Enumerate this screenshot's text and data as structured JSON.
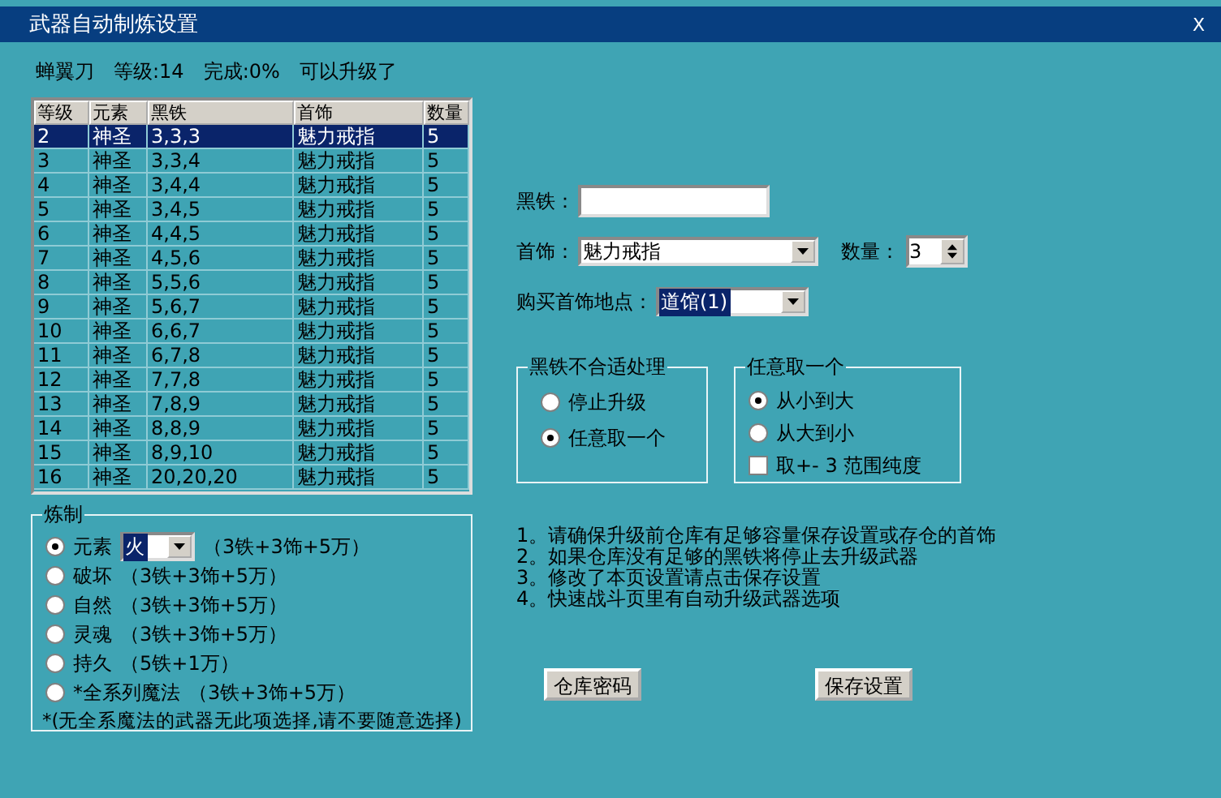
{
  "window": {
    "title": "武器自动制炼设置",
    "close": "X"
  },
  "status": {
    "weapon": "蝉翼刀",
    "level": "等级:14",
    "progress": "完成:0%",
    "message": "可以升级了"
  },
  "table": {
    "columns": [
      "等级",
      "元素",
      "黑铁",
      "首饰",
      "数量"
    ],
    "rows": [
      {
        "cells": [
          "2",
          "神圣",
          "3,3,3",
          "魅力戒指",
          "5"
        ],
        "selected": true
      },
      {
        "cells": [
          "3",
          "神圣",
          "3,3,4",
          "魅力戒指",
          "5"
        ],
        "selected": false
      },
      {
        "cells": [
          "4",
          "神圣",
          "3,4,4",
          "魅力戒指",
          "5"
        ],
        "selected": false
      },
      {
        "cells": [
          "5",
          "神圣",
          "3,4,5",
          "魅力戒指",
          "5"
        ],
        "selected": false
      },
      {
        "cells": [
          "6",
          "神圣",
          "4,4,5",
          "魅力戒指",
          "5"
        ],
        "selected": false
      },
      {
        "cells": [
          "7",
          "神圣",
          "4,5,6",
          "魅力戒指",
          "5"
        ],
        "selected": false
      },
      {
        "cells": [
          "8",
          "神圣",
          "5,5,6",
          "魅力戒指",
          "5"
        ],
        "selected": false
      },
      {
        "cells": [
          "9",
          "神圣",
          "5,6,7",
          "魅力戒指",
          "5"
        ],
        "selected": false
      },
      {
        "cells": [
          "10",
          "神圣",
          "6,6,7",
          "魅力戒指",
          "5"
        ],
        "selected": false
      },
      {
        "cells": [
          "11",
          "神圣",
          "6,7,8",
          "魅力戒指",
          "5"
        ],
        "selected": false
      },
      {
        "cells": [
          "12",
          "神圣",
          "7,7,8",
          "魅力戒指",
          "5"
        ],
        "selected": false
      },
      {
        "cells": [
          "13",
          "神圣",
          "7,8,9",
          "魅力戒指",
          "5"
        ],
        "selected": false
      },
      {
        "cells": [
          "14",
          "神圣",
          "8,8,9",
          "魅力戒指",
          "5"
        ],
        "selected": false
      },
      {
        "cells": [
          "15",
          "神圣",
          "8,9,10",
          "魅力戒指",
          "5"
        ],
        "selected": false
      },
      {
        "cells": [
          "16",
          "神圣",
          "20,20,20",
          "魅力戒指",
          "5"
        ],
        "selected": false
      }
    ]
  },
  "refine": {
    "title": "炼制",
    "options": [
      {
        "label": "元素",
        "selected": true,
        "dropdown": "火",
        "cost": "（3铁+3饰+5万）"
      },
      {
        "label": "破坏",
        "selected": false,
        "cost": "（3铁+3饰+5万）"
      },
      {
        "label": "自然",
        "selected": false,
        "cost": "（3铁+3饰+5万）"
      },
      {
        "label": "灵魂",
        "selected": false,
        "cost": "（3铁+3饰+5万）"
      },
      {
        "label": "持久",
        "selected": false,
        "cost": "（5铁+1万）"
      },
      {
        "label": "*全系列魔法",
        "selected": false,
        "cost": "（3铁+3饰+5万）"
      }
    ],
    "note": "*(无全系魔法的武器无此项选择,请不要随意选择)"
  },
  "form": {
    "iron": {
      "label": "黑铁："
    },
    "accessory": {
      "label": "首饰：",
      "value": "魅力戒指"
    },
    "quantity": {
      "label": "数量：",
      "value": "3"
    },
    "shop": {
      "label": "购买首饰地点：",
      "value": "道馆(1)"
    }
  },
  "iron_handling": {
    "title": "黑铁不合适处理",
    "options": [
      {
        "label": "停止升级",
        "selected": false
      },
      {
        "label": "任意取一个",
        "selected": true
      }
    ]
  },
  "pick_one": {
    "title": "任意取一个",
    "options": [
      {
        "label": "从小到大",
        "selected": true
      },
      {
        "label": "从大到小",
        "selected": false
      }
    ],
    "purity": {
      "label": "取+- 3 范围纯度",
      "checked": false
    }
  },
  "notes": [
    "1。请确保升级前仓库有足够容量保存设置或存仓的首饰",
    "2。如果仓库没有足够的黑铁将停止去升级武器",
    "3。修改了本页设置请点击保存设置",
    "4。快速战斗页里有自动升级武器选项"
  ],
  "buttons": [
    "仓库密码",
    "保存设置"
  ]
}
